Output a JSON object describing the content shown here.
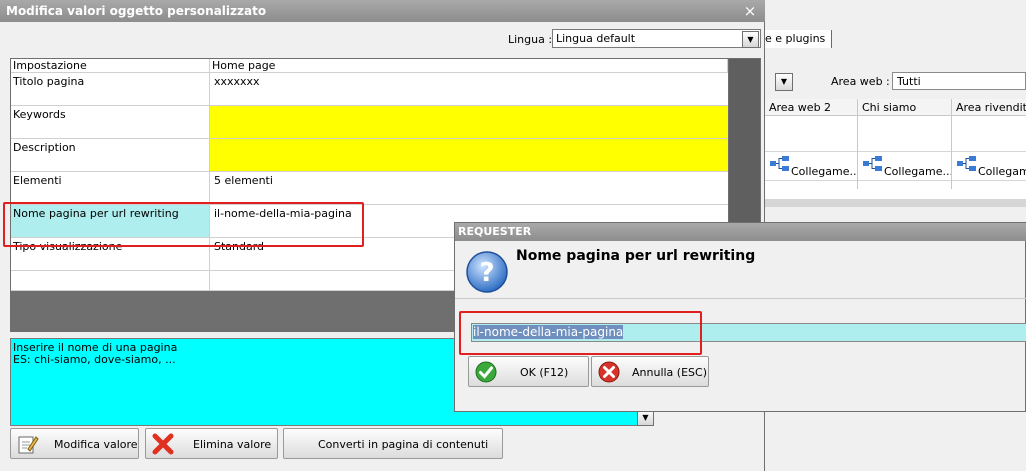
{
  "background_window": {
    "tab_label": "e e plugins",
    "area_web_label": "Area web :",
    "area_web_value": "Tutti",
    "columns": [
      "Area web 2",
      "Chi siamo",
      "Area rivenditori"
    ],
    "cell_text": "Collegame...",
    "colors": {
      "background": "#f0f0f0"
    }
  },
  "main_dialog": {
    "title": "Modifica valori oggetto personalizzato",
    "close_label": "×",
    "lingua_label": "Lingua :",
    "lingua_value": "Lingua default",
    "grid": {
      "headers": [
        "Impostazione",
        "Home page"
      ],
      "rows": [
        {
          "setting": "Titolo pagina",
          "value": "xxxxxxx"
        },
        {
          "setting": "Keywords",
          "value": ""
        },
        {
          "setting": "Description",
          "value": ""
        },
        {
          "setting": "Elementi",
          "value": "5 elementi"
        },
        {
          "setting": "Nome pagina per url rewriting",
          "value": "il-nome-della-mia-pagina"
        },
        {
          "setting": "Tipo visualizzazione",
          "value": "Standard"
        },
        {
          "setting": "",
          "value": ""
        }
      ]
    },
    "hint": {
      "line1": "Inserire il nome di una pagina",
      "line2": "ES: chi-siamo, dove-siamo, ..."
    },
    "buttons": {
      "modifica": "Modifica valore",
      "elimina": "Elimina valore",
      "converti": "Converti in pagina di contenuti"
    },
    "colors": {
      "yellow": "#ffff00",
      "hint_cyan": "#00ffff",
      "selected_row": "#aeeeee",
      "highlight_red": "#e02020"
    }
  },
  "requester": {
    "title": "REQUESTER",
    "heading": "Nome pagina per url rewriting",
    "input_value": "il-nome-della-mia-pagina",
    "ok_label": "OK (F12)",
    "cancel_label": "Annulla (ESC)"
  }
}
